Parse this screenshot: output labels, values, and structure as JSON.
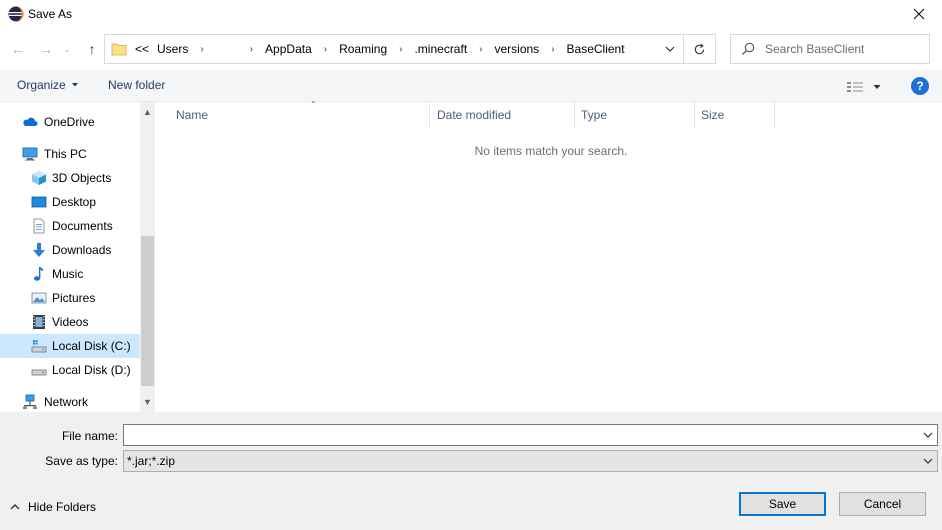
{
  "window": {
    "title": "Save As"
  },
  "address": {
    "crumbs": [
      "Users",
      "",
      "AppData",
      "Roaming",
      ".minecraft",
      "versions",
      "BaseClient"
    ],
    "overflow": "<<"
  },
  "search": {
    "placeholder": "Search BaseClient"
  },
  "toolbar": {
    "organize": "Organize",
    "new_folder": "New folder",
    "help": "?"
  },
  "nav": {
    "items": [
      {
        "label": "OneDrive",
        "icon": "cloud-icon"
      },
      {
        "label": "This PC",
        "icon": "computer-icon"
      },
      {
        "label": "3D Objects",
        "icon": "cube-icon"
      },
      {
        "label": "Desktop",
        "icon": "desktop-icon"
      },
      {
        "label": "Documents",
        "icon": "document-icon"
      },
      {
        "label": "Downloads",
        "icon": "download-arrow-icon"
      },
      {
        "label": "Music",
        "icon": "music-note-icon"
      },
      {
        "label": "Pictures",
        "icon": "picture-icon"
      },
      {
        "label": "Videos",
        "icon": "film-icon"
      },
      {
        "label": "Local Disk (C:)",
        "icon": "drive-icon"
      },
      {
        "label": "Local Disk (D:)",
        "icon": "drive-icon"
      },
      {
        "label": "Network",
        "icon": "network-icon"
      }
    ]
  },
  "columns": [
    "Name",
    "Date modified",
    "Type",
    "Size"
  ],
  "empty_message": "No items match your search.",
  "form": {
    "file_name_label": "File name:",
    "file_name_value": "",
    "save_type_label": "Save as type:",
    "save_type_value": "*.jar;*.zip"
  },
  "footer": {
    "hide_folders": "Hide Folders",
    "save": "Save",
    "cancel": "Cancel"
  }
}
